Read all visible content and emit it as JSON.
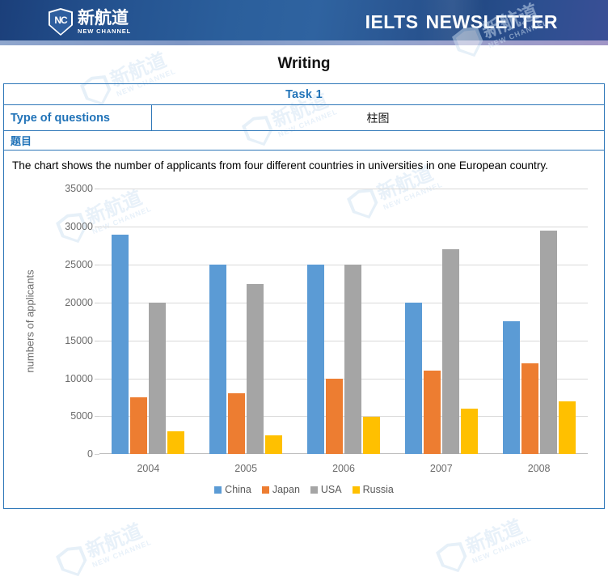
{
  "header": {
    "logo_cn": "新航道",
    "logo_en": "NEW CHANNEL",
    "logo_mark": "NC",
    "title_left": "IELTS",
    "title_right": "NEWSLETTER",
    "band_color": "#2b5f9c",
    "stripe_color": "#8fa6cd"
  },
  "page_title": "Writing",
  "table": {
    "task_label": "Task 1",
    "type_label": "Type of questions",
    "type_value": "柱图",
    "question_label": "题目",
    "border_color": "#2e77b8",
    "heading_color": "#2173b8"
  },
  "prompt": "The chart shows the number of applicants from four different countries in universities in one European country.",
  "watermark": {
    "cn": "新航道",
    "en": "NEW CHANNEL"
  },
  "chart_data": {
    "type": "bar",
    "title": "",
    "xlabel": "",
    "ylabel": "numbers of applicants",
    "categories": [
      "2004",
      "2005",
      "2006",
      "2007",
      "2008"
    ],
    "series": [
      {
        "name": "China",
        "color": "#5B9BD5",
        "values": [
          29000,
          25000,
          25000,
          20000,
          17500
        ]
      },
      {
        "name": "Japan",
        "color": "#ED7D31",
        "values": [
          7500,
          8000,
          10000,
          11000,
          12000
        ]
      },
      {
        "name": "USA",
        "color": "#A5A5A5",
        "values": [
          20000,
          22500,
          25000,
          27000,
          29500
        ]
      },
      {
        "name": "Russia",
        "color": "#FFC000",
        "values": [
          3000,
          2500,
          5000,
          6000,
          7000
        ]
      }
    ],
    "ylim": [
      0,
      35000
    ],
    "yticks": [
      0,
      5000,
      10000,
      15000,
      20000,
      25000,
      30000,
      35000
    ],
    "grid": true,
    "legend_position": "bottom",
    "gridline_color": "#d9d9d9",
    "tick_label_color": "#6b6b6b"
  }
}
